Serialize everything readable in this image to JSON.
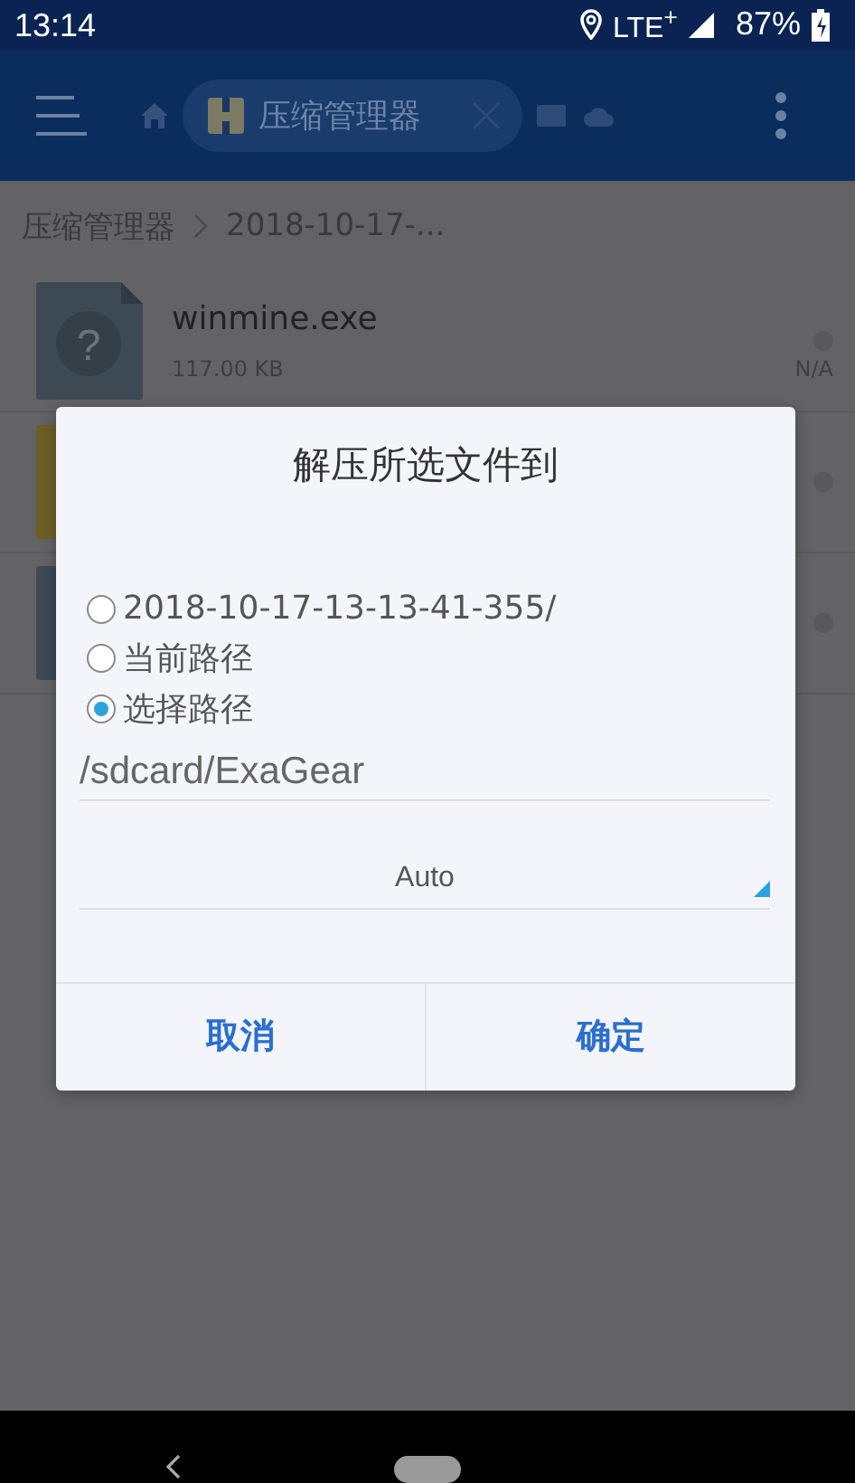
{
  "status_bar": {
    "time": "13:14",
    "network": "LTE$^{+}$",
    "battery": "87%"
  },
  "app_bar": {
    "tab_title": "压缩管理器"
  },
  "breadcrumb": [
    "压缩管理器",
    "2018-10-17-..."
  ],
  "files": [
    {
      "kind": "unknown",
      "glyph": "?",
      "name": "winmine.exe",
      "size": "117.00 KB",
      "date": "N/A"
    },
    {
      "kind": "folder"
    },
    {
      "kind": "file"
    }
  ],
  "dialog": {
    "title": "解压所选文件到",
    "options": [
      {
        "label": "2018-10-17-13-13-41-355/",
        "selected": false
      },
      {
        "label": "当前路径",
        "selected": false
      },
      {
        "label": "选择路径",
        "selected": true
      }
    ],
    "path_value": "/sdcard/ExaGear",
    "encoding": "Auto",
    "buttons": [
      "取消",
      "确定"
    ]
  }
}
